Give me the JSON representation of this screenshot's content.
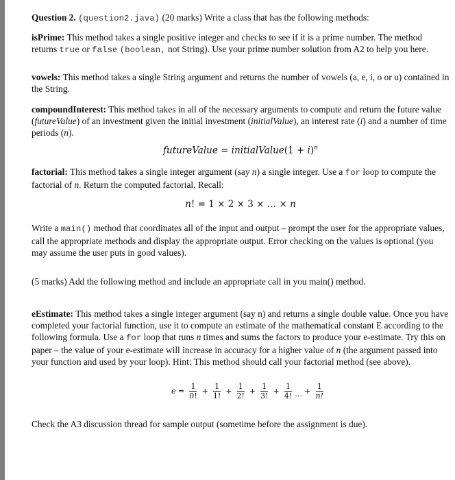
{
  "question": {
    "label": "Question 2.",
    "file": "(question2.java)",
    "marks": "(20 marks)",
    "intro": "Write a class that has the following methods:"
  },
  "isPrime": {
    "name": "isPrime:",
    "text1": "This method takes a single positive integer and checks to see if it is a prime number.  The method returns ",
    "code_true": "true",
    "or": " or ",
    "code_false": "false",
    "space": " ",
    "code_boolean": "(boolean,",
    "text2": " not String).  Use your prime number solution from A2 to help you here."
  },
  "vowels": {
    "name": "vowels:",
    "text": "  This method takes a single String argument and returns the number of vowels (a, e, i, o or u) contained in the String."
  },
  "compoundInterest": {
    "name": "compoundInterest:",
    "text1": " This method takes in all of the necessary arguments to compute and return the future value (",
    "var_future": "futureValue",
    "text2": ") of an investment given the initial investment (",
    "var_initial": "initialValue",
    "text3": "), an interest rate (",
    "var_i": "i",
    "text4": ") and a number of time periods (",
    "var_n": "n",
    "text5": ")."
  },
  "formula_future": {
    "lhs": "futureValue",
    "eq": " = ",
    "rhs": "initialValue",
    "paren": "(1 + ",
    "i": "i",
    "close": ")",
    "exp": "n"
  },
  "factorial": {
    "name": "factorial:",
    "text1": " This method takes a single integer argument (say ",
    "var_n": "n",
    "text2": ") a single integer.  Use a ",
    "code_for": "for",
    "text3": " loop to compute the factorial of ",
    "var_n2": "n",
    "text4": ". Return the computed factorial.  Recall:"
  },
  "formula_factorial": {
    "lhs": "n",
    "rest": "! = 1 × 2 × 3 × … × ",
    "n": "n"
  },
  "main_para": {
    "text1": "Write a ",
    "code_main": "main()",
    "text2": " method that coordinates all of the input and output – prompt the user for the appropriate values, call the appropriate methods and display the appropriate output.  Error checking on the values is optional (you may assume the user puts in good values)."
  },
  "bonus": {
    "text": "(5 marks) Add the following method and include an appropriate call in you main() method."
  },
  "eEstimate": {
    "name": "eEstimate:",
    "text1": "  This method takes a single integer argument (say n) and returns a single double value.  Once you have completed your factorial function, use it to compute an estimate of the mathematical constant E according to the following formula.  Use a ",
    "code_for": "for",
    "text2": " loop that runs ",
    "var_n": "n",
    "text3": " times and sums the factors to produce your e-estimate.  Try this on paper – the value of your e-estimate will increase in accuracy for a higher value of ",
    "var_n2": "n",
    "text4": " (the argument passed into your function and used by your loop).  Hint: This method should call your factorial method (see above)."
  },
  "formula_e": {
    "lhs": "e =",
    "terms": [
      {
        "num": "1",
        "den": "0!"
      },
      {
        "num": "1",
        "den": "1!"
      },
      {
        "num": "1",
        "den": "2!"
      },
      {
        "num": "1",
        "den": "3!"
      },
      {
        "num": "1",
        "den": "4!"
      },
      {
        "num": "1",
        "den": "n!"
      }
    ],
    "plus": "+",
    "ellipsis": "…"
  },
  "footer": {
    "text": "Check the A3 discussion thread for sample output (sometime before the assignment is due)."
  }
}
